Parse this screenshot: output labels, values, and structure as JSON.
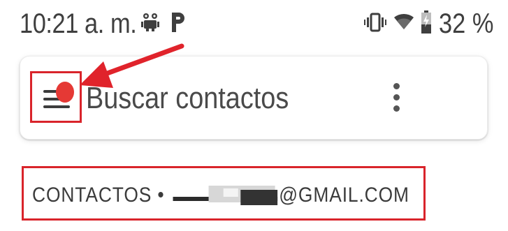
{
  "status_bar": {
    "time": "10:21 a. m.",
    "notification_icons": [
      "android-debug-icon",
      "parking-icon"
    ],
    "system_icons": [
      "vibrate-icon",
      "wifi-icon",
      "battery-icon"
    ],
    "battery_percent": "32 %"
  },
  "search": {
    "placeholder": "Buscar contactos",
    "menu_icon": "hamburger-menu-icon",
    "more_icon": "more-vert-icon"
  },
  "account": {
    "label": "CONTACTOS •",
    "email_suffix": "@GMAIL.COM"
  },
  "annotation": {
    "highlight_color": "#d9242b"
  }
}
